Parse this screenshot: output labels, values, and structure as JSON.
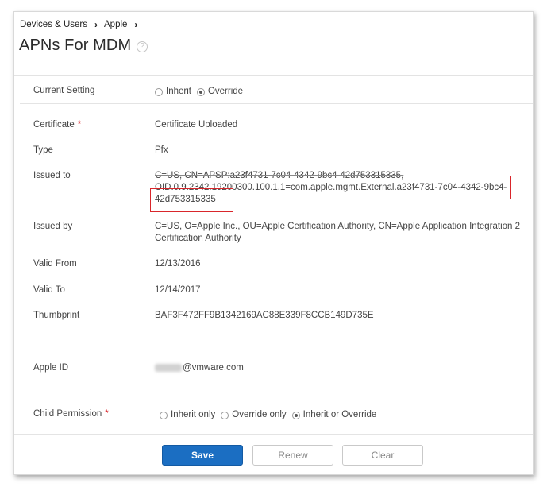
{
  "breadcrumb": {
    "item1": "Devices & Users",
    "item2": "Apple",
    "separator_icon": "chevron-right-icon"
  },
  "page": {
    "title": "APNs For MDM",
    "help_icon": "question-circle-icon"
  },
  "current_setting": {
    "label": "Current Setting",
    "options": [
      "Inherit",
      "Override"
    ],
    "selected": "Override"
  },
  "fields": {
    "certificate": {
      "label": "Certificate",
      "required": "*",
      "value": "Certificate Uploaded"
    },
    "type": {
      "label": "Type",
      "value": "Pfx"
    },
    "issued_to": {
      "label": "Issued to",
      "line1": "C=US, CN=APSP:a23f4731-7c04-4342-9bc4-42d753315335,",
      "line2_struck": "OID.0.9.2342.19200300.100.1.1",
      "line2_rest": "=com.apple.mgmt.External.a23f4731-7c04-4342-9bc4-",
      "line3": "42d753315335"
    },
    "issued_by": {
      "label": "Issued by",
      "line1": "C=US, O=Apple Inc., OU=Apple Certification Authority, CN=Apple Application Integration 2",
      "line2": "Certification Authority"
    },
    "valid_from": {
      "label": "Valid From",
      "value": "12/13/2016"
    },
    "valid_to": {
      "label": "Valid To",
      "value": "12/14/2017"
    },
    "thumbprint": {
      "label": "Thumbprint",
      "value": "BAF3F472FF9B1342169AC88E339F8CCB149D735E"
    },
    "apple_id": {
      "label": "Apple ID",
      "value_suffix": "@vmware.com"
    }
  },
  "child_permission": {
    "label": "Child Permission",
    "required": "*",
    "options": [
      "Inherit only",
      "Override only",
      "Inherit or Override"
    ],
    "selected": "Inherit or Override"
  },
  "buttons": {
    "save": "Save",
    "renew": "Renew",
    "clear": "Clear"
  },
  "colors": {
    "primary": "#1b6ec2",
    "highlight": "#d9262b",
    "required": "#d9262b"
  }
}
